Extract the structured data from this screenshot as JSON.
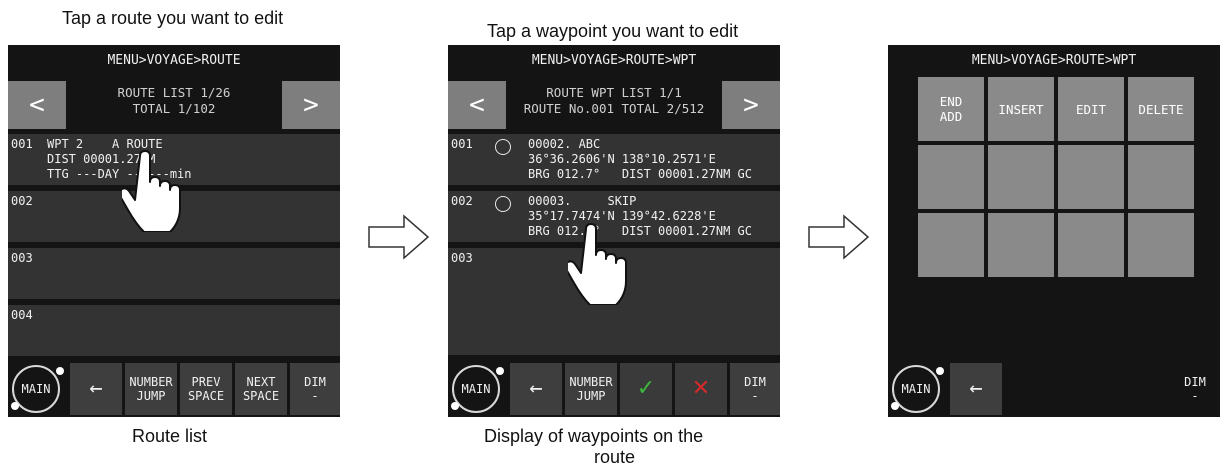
{
  "captions": {
    "top_left": "Tap a route you want to edit",
    "top_mid": "Tap a waypoint you want to edit",
    "bottom_left": "Route list",
    "bottom_mid_line1": "Display of waypoints on the",
    "bottom_mid_line2": "route"
  },
  "screen1": {
    "title": "MENU>VOYAGE>ROUTE",
    "prev": "<",
    "next": ">",
    "header_line1": "ROUTE LIST 1/26",
    "header_line2": "TOTAL 1/102",
    "rows": [
      {
        "num": "001",
        "line1": "WPT 2    A ROUTE",
        "line2": "DIST 00001.27NM",
        "line3": "TTG ---DAY --h---min"
      },
      {
        "num": "002"
      },
      {
        "num": "003"
      },
      {
        "num": "004"
      }
    ],
    "bottom": {
      "main": "MAIN",
      "back": "←",
      "number_jump_1": "NUMBER",
      "number_jump_2": "JUMP",
      "prev_space_1": "PREV",
      "prev_space_2": "SPACE",
      "next_space_1": "NEXT",
      "next_space_2": "SPACE",
      "dim_1": "DIM",
      "dim_2": "-"
    }
  },
  "screen2": {
    "title": "MENU>VOYAGE>ROUTE>WPT",
    "prev": "<",
    "next": ">",
    "header_line1": "ROUTE WPT LIST 1/1",
    "header_line2": "ROUTE No.001 TOTAL 2/512",
    "rows": [
      {
        "num": "001",
        "line1": "00002. ABC",
        "line2": "36°36.2606'N 138°10.2571'E",
        "line3": "BRG 012.7°   DIST 00001.27NM GC"
      },
      {
        "num": "002",
        "line1": "00003.     SKIP",
        "line2": "35°17.7474'N 139°42.6228'E",
        "line3": "BRG 012.7°   DIST 00001.27NM GC"
      },
      {
        "num": "003"
      }
    ],
    "bottom": {
      "main": "MAIN",
      "back": "←",
      "number_jump_1": "NUMBER",
      "number_jump_2": "JUMP",
      "ok": "✓",
      "cancel": "✕",
      "dim_1": "DIM",
      "dim_2": "-"
    }
  },
  "screen3": {
    "title": "MENU>VOYAGE>ROUTE>WPT",
    "buttons": {
      "end_add_1": "END",
      "end_add_2": "ADD",
      "insert": "INSERT",
      "edit": "EDIT",
      "delete": "DELETE"
    },
    "bottom": {
      "main": "MAIN",
      "back": "←",
      "dim_1": "DIM",
      "dim_2": "-"
    }
  },
  "colors": {
    "screen_bg": "#141414",
    "row_bg": "#333333",
    "nav_button": "#7e7e7e",
    "ok_green": "#3cb83c",
    "cancel_red": "#d42a2a"
  }
}
